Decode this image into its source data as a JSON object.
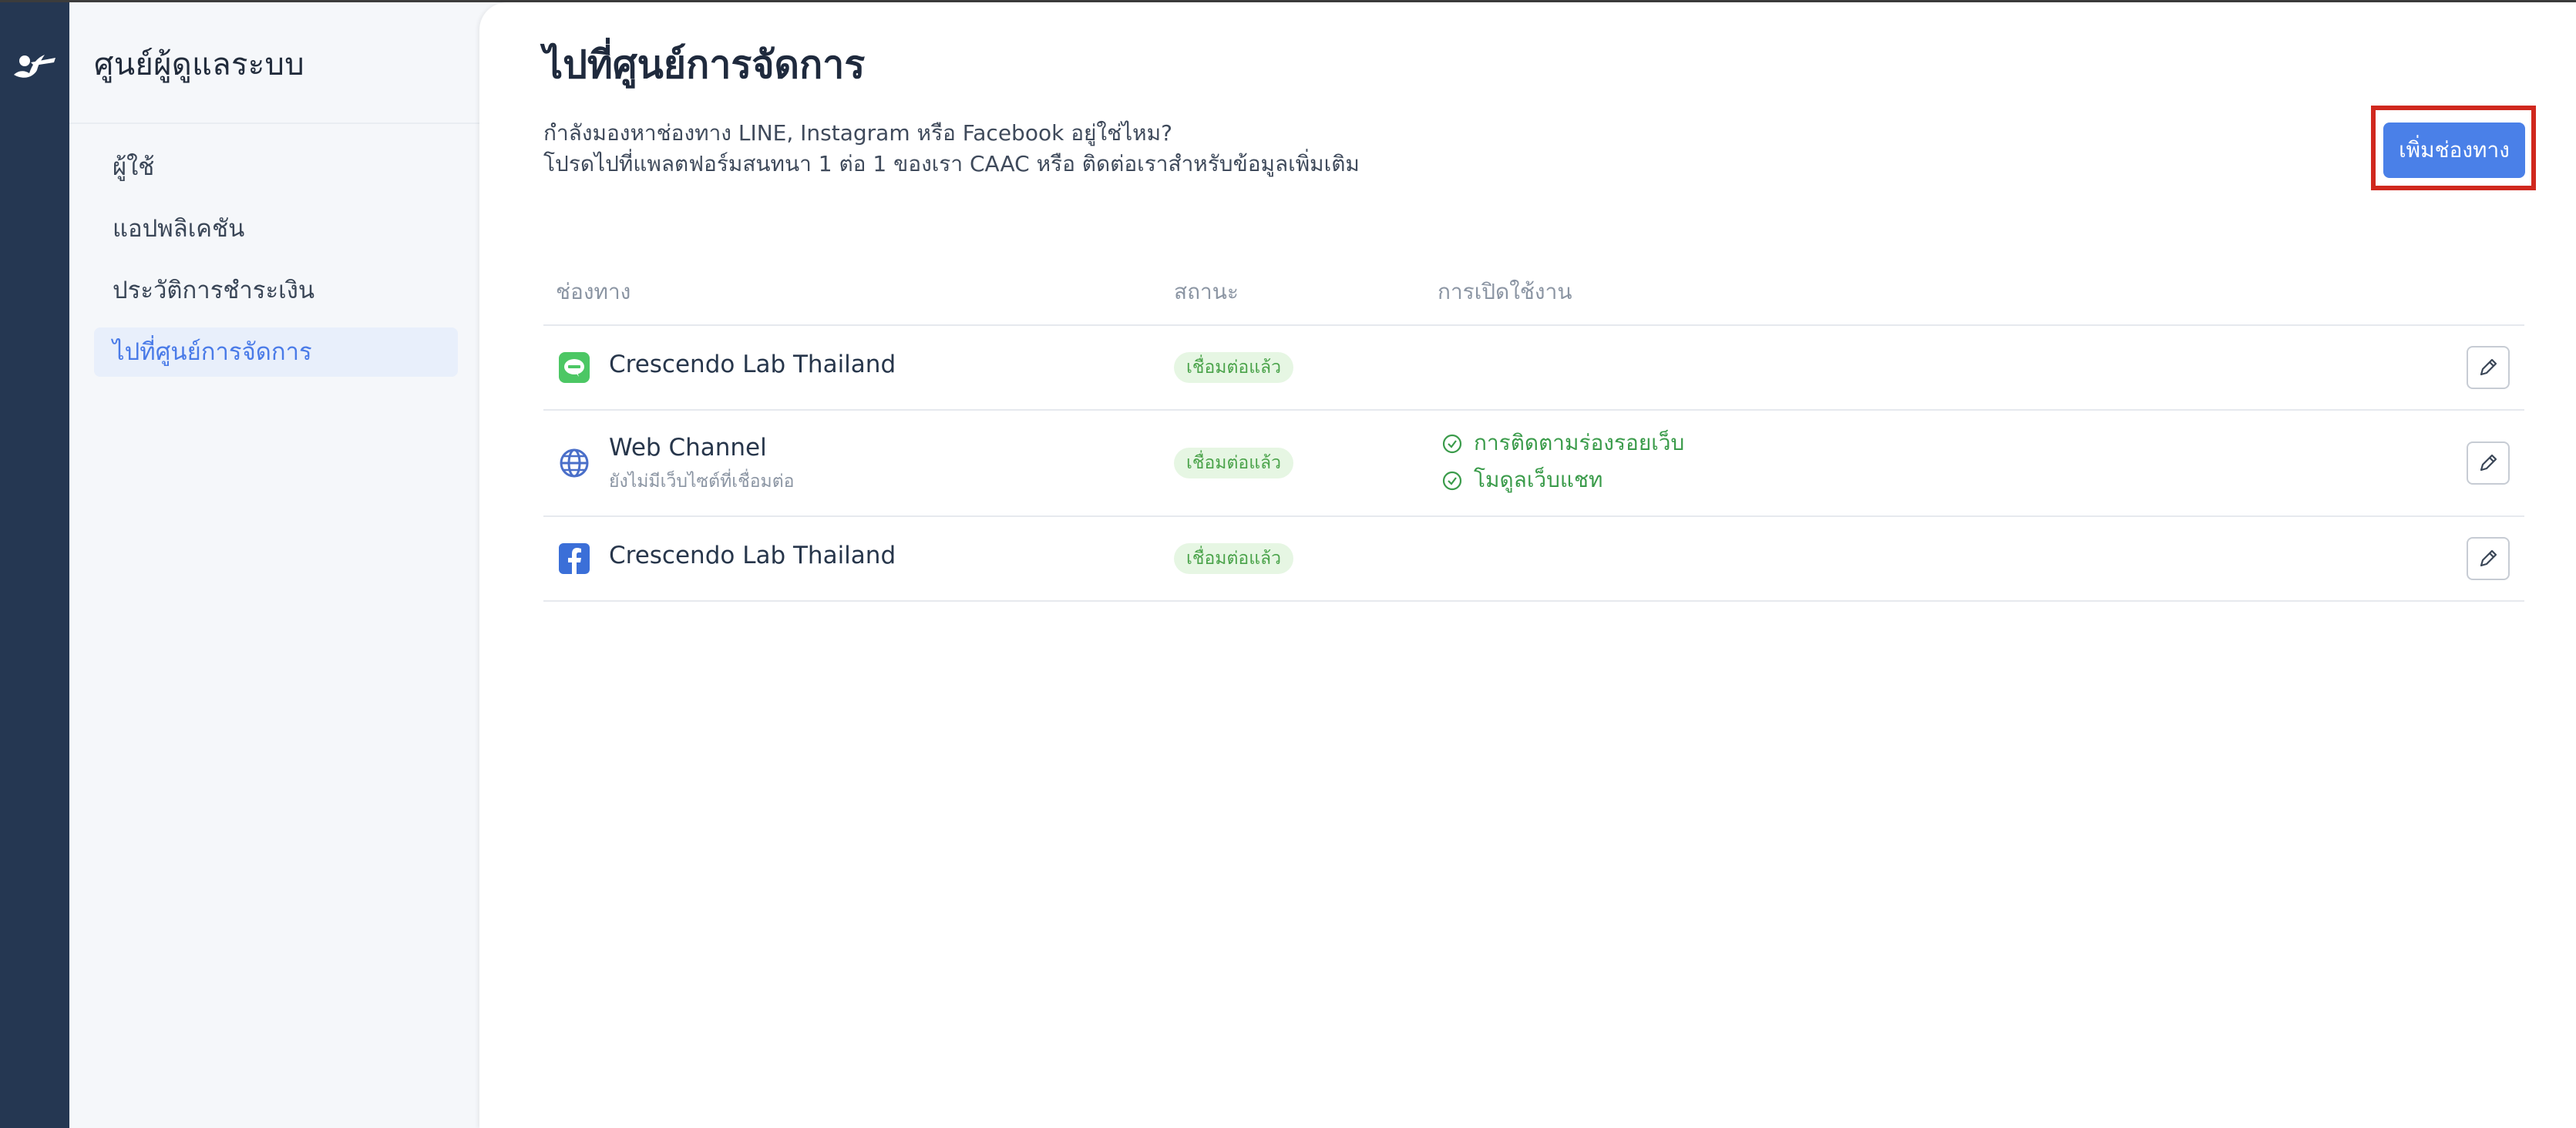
{
  "sidebar": {
    "title": "ศูนย์ผู้ดูแลระบบ",
    "items": [
      {
        "label": "ผู้ใช้",
        "active": false
      },
      {
        "label": "แอปพลิเคชัน",
        "active": false
      },
      {
        "label": "ประวัติการชำระเงิน",
        "active": false
      },
      {
        "label": "ไปที่ศูนย์การจัดการ",
        "active": true
      }
    ]
  },
  "main": {
    "title": "ไปที่ศูนย์การจัดการ",
    "desc_line1": "กำลังมองหาช่องทาง LINE, Instagram หรือ Facebook อยู่ใช่ไหม?",
    "desc_line2": "โปรดไปที่แพลตฟอร์มสนทนา 1 ต่อ 1 ของเรา CAAC หรือ ติดต่อเราสำหรับข้อมูลเพิ่มเติม",
    "add_button": "เพิ่มช่องทาง"
  },
  "table": {
    "headers": {
      "channel": "ช่องทาง",
      "status": "สถานะ",
      "activation": "การเปิดใช้งาน"
    },
    "rows": [
      {
        "icon": "line-icon",
        "name": "Crescendo Lab Thailand",
        "sub": "",
        "status": "เชื่อมต่อแล้ว",
        "features": []
      },
      {
        "icon": "globe-icon",
        "name": "Web Channel",
        "sub": "ยังไม่มีเว็บไซต์ที่เชื่อมต่อ",
        "status": "เชื่อมต่อแล้ว",
        "features": [
          "การติดตามร่องรอยเว็บ",
          "โมดูลเว็บแชท"
        ]
      },
      {
        "icon": "facebook-icon",
        "name": "Crescendo Lab Thailand",
        "sub": "",
        "status": "เชื่อมต่อแล้ว",
        "features": []
      }
    ]
  },
  "colors": {
    "accent": "#4a80e8",
    "rail": "#253752",
    "status_green": "#4aa34a",
    "highlight": "#d0281e"
  }
}
